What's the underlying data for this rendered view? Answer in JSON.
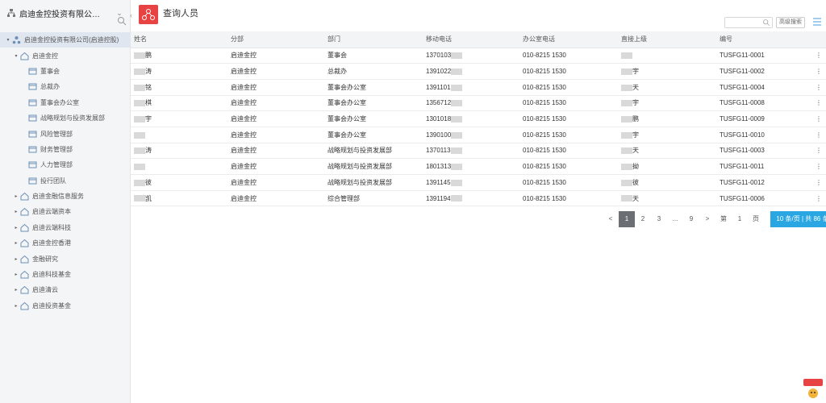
{
  "sidebar": {
    "org_title": "启迪金控投资有限公…",
    "tree": [
      {
        "label": "启迪金控投资有限公司(启迪控股)",
        "indent": 0,
        "expanded": true,
        "selected": true
      },
      {
        "label": "启迪金控",
        "indent": 1,
        "expanded": true
      },
      {
        "label": "董事会",
        "indent": 2
      },
      {
        "label": "总裁办",
        "indent": 2
      },
      {
        "label": "董事会办公室",
        "indent": 2
      },
      {
        "label": "战略规划与投资发展部",
        "indent": 2
      },
      {
        "label": "风险管理部",
        "indent": 2
      },
      {
        "label": "财务管理部",
        "indent": 2
      },
      {
        "label": "人力管理部",
        "indent": 2
      },
      {
        "label": "投行团队",
        "indent": 2
      },
      {
        "label": "启迪金融信息服务",
        "indent": 1,
        "expanded": false
      },
      {
        "label": "启迪云端资本",
        "indent": 1,
        "expanded": false
      },
      {
        "label": "启迪云端科技",
        "indent": 1,
        "expanded": false
      },
      {
        "label": "启迪金控香港",
        "indent": 1,
        "expanded": false
      },
      {
        "label": "金融研究",
        "indent": 1,
        "expanded": false
      },
      {
        "label": "启迪科技基金",
        "indent": 1,
        "expanded": false
      },
      {
        "label": "启迪清云",
        "indent": 1,
        "expanded": false
      },
      {
        "label": "启迪投资基金",
        "indent": 1,
        "expanded": false
      }
    ]
  },
  "main": {
    "title": "查询人员",
    "search_placeholder": "",
    "advanced_search": "高级搜索",
    "columns": [
      "姓名",
      "分部",
      "部门",
      "移动电话",
      "办公室电话",
      "直接上级",
      "编号"
    ],
    "rows": [
      [
        "鹏",
        "启迪金控",
        "董事会",
        "1370103",
        "010-8215 1530",
        "",
        "TUSFG11-0001"
      ],
      [
        "涛",
        "启迪金控",
        "总裁办",
        "1391022",
        "010-8215 1530",
        "宇",
        "TUSFG11-0002"
      ],
      [
        "铭",
        "启迪金控",
        "董事会办公室",
        "1391101",
        "010-8215 1530",
        "天",
        "TUSFG11-0004"
      ],
      [
        "棋",
        "启迪金控",
        "董事会办公室",
        "1356712",
        "010-8215 1530",
        "宇",
        "TUSFG11-0008"
      ],
      [
        "宇",
        "启迪金控",
        "董事会办公室",
        "1301018",
        "010-8215 1530",
        "鹏",
        "TUSFG11-0009"
      ],
      [
        "",
        "启迪金控",
        "董事会办公室",
        "1390100",
        "010-8215 1530",
        "宇",
        "TUSFG11-0010"
      ],
      [
        "涛",
        "启迪金控",
        "战略规划与投资发展部",
        "1370113",
        "010-8215 1530",
        "天",
        "TUSFG11-0003"
      ],
      [
        "",
        "启迪金控",
        "战略规划与投资发展部",
        "1801313",
        "010-8215 1530",
        "拗",
        "TUSFG11-0011"
      ],
      [
        "彼",
        "启迪金控",
        "战略规划与投资发展部",
        "1391145",
        "010-8215 1530",
        "彼",
        "TUSFG11-0012"
      ],
      [
        "凯",
        "启迪金控",
        "综合管理部",
        "1391194",
        "010-8215 1530",
        "天",
        "TUSFG11-0006"
      ]
    ],
    "pager": {
      "prev": "<",
      "pages": [
        "1",
        "2",
        "3",
        "...",
        "9"
      ],
      "current": "1",
      "next": ">",
      "jump_prefix": "第",
      "jump_value": "1",
      "jump_suffix": "页",
      "page_size": "10 条/页 | 共 86 条"
    }
  },
  "colors": {
    "accent": "#2aa7e3",
    "page_icon": "#e84343",
    "current_page": "#6b6e72"
  }
}
